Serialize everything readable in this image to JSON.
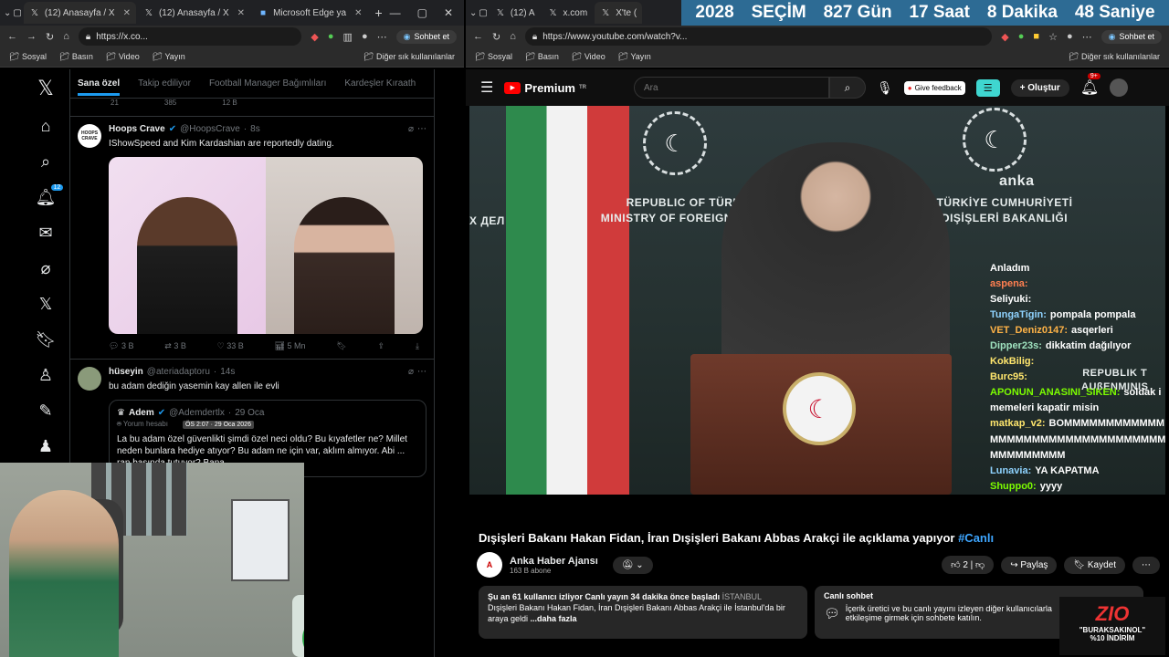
{
  "left_window": {
    "tabs": [
      {
        "label": "(12) Anasayfa / X",
        "active": true
      },
      {
        "label": "(12) Anasayfa / X",
        "active": false
      },
      {
        "label": "Microsoft Edge ya",
        "active": false
      }
    ],
    "url": "https://x.co...",
    "chat_button": "Sohbet et",
    "bookmarks": [
      "Sosyal",
      "Basın",
      "Video",
      "Yayın"
    ],
    "bookmarks_other": "Diğer sık kullanılanlar"
  },
  "x": {
    "notification_badge": "12",
    "tabs": [
      "Sana özel",
      "Takip ediliyor",
      "Football Manager Bağımlıları",
      "Kardeşler Kıraath"
    ],
    "strip_stats": [
      "21",
      "385",
      "12 B"
    ],
    "tweets": [
      {
        "name": "Hoops Crave",
        "handle": "@HoopsCrave",
        "time": "8s",
        "avatar_text": "HOOPS CRAVE",
        "text": "IShowSpeed and Kim Kardashian are reportedly dating.",
        "stats": {
          "replies": "3 B",
          "reposts": "3 B",
          "likes": "33 B",
          "views": "5 Mn"
        }
      },
      {
        "name": "hüseyin",
        "handle": "@ateriadaptoru",
        "time": "14s",
        "text": "bu adam dediğin yasemin kay allen ile evli",
        "quote": {
          "name": "Adem",
          "handle": "@Ademdertlx",
          "time": "29 Oca",
          "label": "Yorum hesabı",
          "tooltip": "ÖS 2:07 · 29 Oca 2026",
          "text": "La bu adam özel güvenlikti şimdi özel neci oldu? Bu kıyafetler ne? Millet neden bunlara hediye atıyor? Bu adam ne için var, aklım almıyor. Abi ... ran başında tutuyor? Bana"
        }
      }
    ]
  },
  "right_window": {
    "tabs": [
      {
        "label": "(12) A",
        "active": false
      },
      {
        "label": "x.com",
        "active": false
      },
      {
        "label": "X'te (",
        "active": true
      }
    ],
    "url": "https://www.youtube.com/watch?v...",
    "chat_button": "Sohbet et",
    "bookmarks": [
      "Sosyal",
      "Basın",
      "Video",
      "Yayın"
    ],
    "bookmarks_other": "Diğer sık kullanılanlar"
  },
  "countdown": [
    "2028",
    "SEÇİM",
    "827 Gün",
    "17 Saat",
    "8 Dakika",
    "48 Saniye"
  ],
  "youtube": {
    "logo": "Premium",
    "logo_sup": "TR",
    "search_placeholder": "Ara",
    "feedback": "Give feedback",
    "create": "Oluştur",
    "notif": "9+",
    "video_texts": {
      "left_sign": "REPUBLIC OF TÜRKİYE\nMINISTRY OF FOREIGN AFFAIRS",
      "right_sign": "TÜRKİYE CUMHURİYETİ\nDIŞİŞLERİ BAKANLIĞI",
      "anka": "anka",
      "edge_left": "Х ДЕЛ",
      "edge_right": "REPUBLIK T\nAUßENMINIS"
    },
    "chat": [
      {
        "user": "Anladım",
        "msg": "",
        "color": "#ffffff"
      },
      {
        "user": "aspena:",
        "msg": "",
        "color": "#ff7f50"
      },
      {
        "user": "Seliyuki:",
        "msg": "",
        "color": "#ffffff"
      },
      {
        "user": "TungaTigin:",
        "msg": "pompala pompala",
        "color": "#8fd3ff"
      },
      {
        "user": "VET_Deniz0147:",
        "msg": "asqerleri",
        "color": "#ffb347"
      },
      {
        "user": "Dipper23s:",
        "msg": "dikkatim dağılıyor",
        "color": "#9fe2bf"
      },
      {
        "user": "KokBilig:",
        "msg": "",
        "color": "#ffe66d"
      },
      {
        "user": "Burc95:",
        "msg": "",
        "color": "#ffe66d"
      },
      {
        "user": "APONUN_ANASINI_SIKEN:",
        "msg": "soldak i memeleri kapatir misin",
        "color": "#7CFC00"
      },
      {
        "user": "matkap_v2:",
        "msg": "BOMMMMMMMMMMMMMMMMMMMMMMMMMMMMMMMMMMMMMMMMMM",
        "color": "#ffe66d"
      },
      {
        "user": "Lunavia:",
        "msg": "YA KAPATMA",
        "color": "#8fd3ff"
      },
      {
        "user": "Shuppo0:",
        "msg": "yyyy",
        "color": "#7CFC00"
      }
    ],
    "title_main": "Dışişleri Bakanı Hakan Fidan, İran Dışişleri Bakanı Abbas Arakçi ile açıklama yapıyor",
    "title_hash": "#Canlı",
    "channel": "Anka Haber Ajansı",
    "subs": "163 B abone",
    "likes": "2",
    "save": "Kaydet",
    "share": "Paylaş",
    "desc_meta": "Şu an 61 kullanıcı izliyor  Canlı yayın 34 dakika önce başladı",
    "desc_loc": "İSTANBUL",
    "desc_text": "Dışişleri Bakanı Hakan Fidan, İran Dışişleri Bakanı Abbas Arakçi ile İstanbul'da bir araya geldi",
    "desc_more": "...daha fazla",
    "livechat_title": "Canlı sohbet",
    "livechat_text": "İçerik üretici ve bu canlı yayını izleyen diğer kullanıcılarla etkileşime girmek için sohbete katılın."
  },
  "overlay": {
    "zio": "ZIO",
    "promo": "\"BURAKSAKINOL\"\n%10 İNDİRİM"
  }
}
